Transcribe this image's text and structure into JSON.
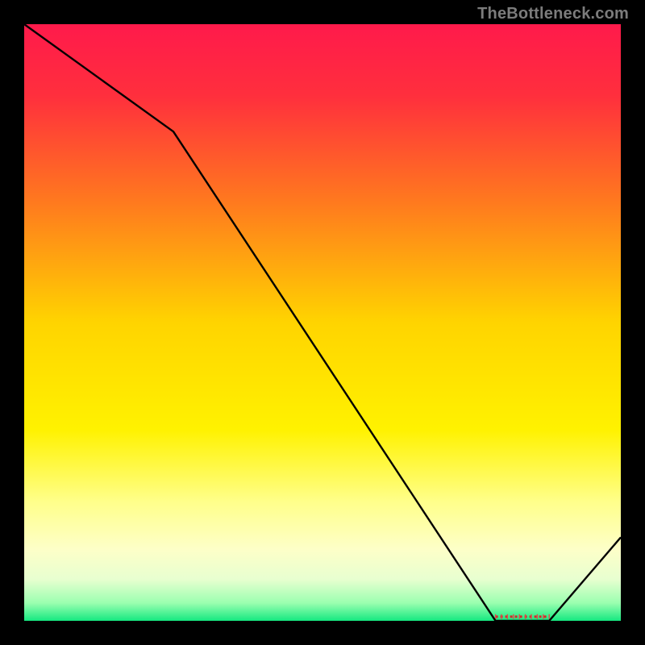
{
  "watermark": "TheBottleneck.com",
  "chart_data": {
    "type": "line",
    "title": "",
    "xlabel": "",
    "ylabel": "",
    "xlim": [
      0,
      100
    ],
    "ylim": [
      0,
      100
    ],
    "x": [
      0,
      25,
      79,
      88,
      100
    ],
    "values": [
      100,
      82,
      0,
      0,
      14
    ],
    "gradient_stops": [
      {
        "offset": 0.0,
        "color": "#ff1a4b"
      },
      {
        "offset": 0.12,
        "color": "#ff2f3d"
      },
      {
        "offset": 0.3,
        "color": "#ff7a1e"
      },
      {
        "offset": 0.5,
        "color": "#ffd400"
      },
      {
        "offset": 0.68,
        "color": "#fff200"
      },
      {
        "offset": 0.8,
        "color": "#ffff8a"
      },
      {
        "offset": 0.88,
        "color": "#fdffc8"
      },
      {
        "offset": 0.93,
        "color": "#e8ffd0"
      },
      {
        "offset": 0.97,
        "color": "#9bffb0"
      },
      {
        "offset": 1.0,
        "color": "#15e880"
      }
    ],
    "marker": {
      "x_range": [
        79,
        88
      ],
      "y": 0.7,
      "color": "#d02a2a",
      "tick_color": "#e24a4a"
    }
  }
}
